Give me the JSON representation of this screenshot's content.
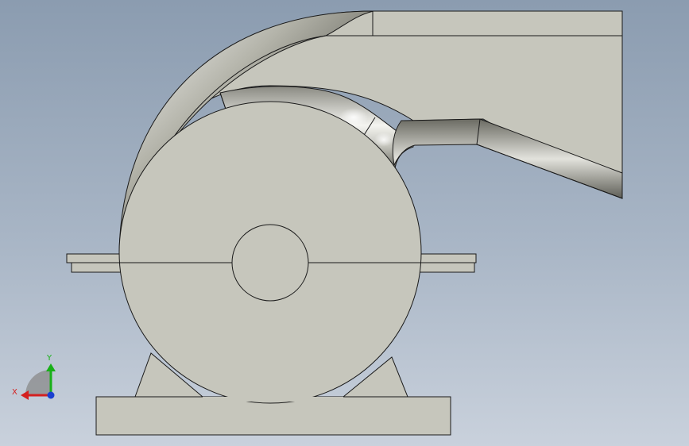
{
  "triad": {
    "x_label": "X",
    "y_label": "Y",
    "x_color": "#d42020",
    "y_color": "#18b018",
    "z_color": "#1a3fd0"
  },
  "colors": {
    "background_top": "#8b9cb0",
    "background_bottom": "#c9d1dc",
    "part_face": "#c6c6bc",
    "edge": "#1a1a1a"
  }
}
